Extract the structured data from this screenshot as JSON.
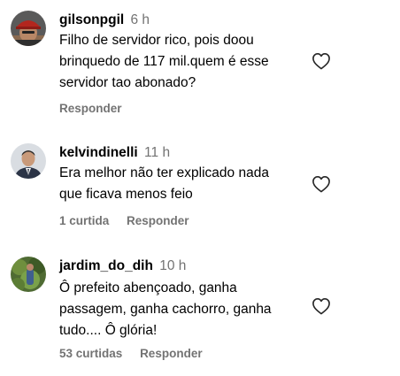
{
  "comments": [
    {
      "username": "gilsonpgil",
      "time": "6 h",
      "lines": [
        "Filho de servidor rico, pois doou",
        "brinquedo de 117 mil.quem é esse",
        "servidor tao abonado?"
      ],
      "likes": "",
      "reply_label": "Responder",
      "avatar": "avatar-red-cap-man"
    },
    {
      "username": "kelvindinelli",
      "time": "11 h",
      "lines": [
        "Era melhor não ter explicado nada",
        "que ficava menos feio"
      ],
      "likes": "1 curtida",
      "reply_label": "Responder",
      "avatar": "avatar-suit-man"
    },
    {
      "username": "jardim_do_dih",
      "time": "10 h",
      "lines": [
        "Ô prefeito abençoado, ganha",
        "passagem, ganha cachorro, ganha",
        "tudo.... Ô glória!"
      ],
      "likes": "53 curtidas",
      "reply_label": "Responder",
      "avatar": "avatar-garden-plant"
    }
  ],
  "colors": {
    "text": "#000000",
    "secondary": "#737373"
  },
  "icons": {
    "like": "heart-outline-icon"
  }
}
